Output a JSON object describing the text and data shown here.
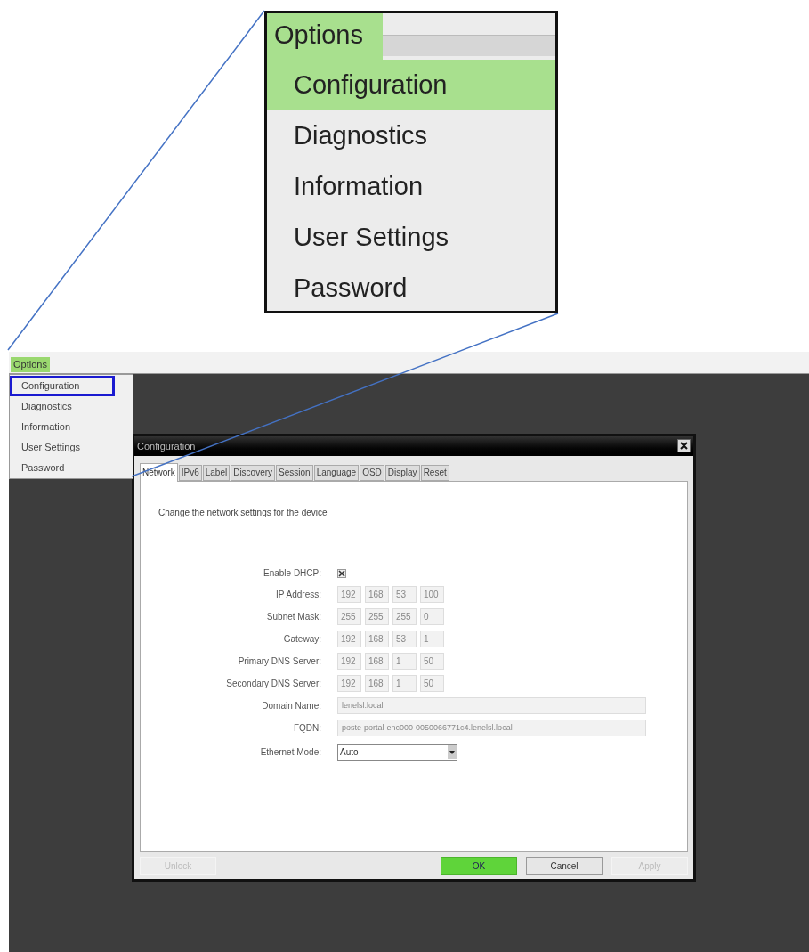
{
  "callout": {
    "menu_title": "Options",
    "items": [
      {
        "label": "Configuration",
        "selected": true
      },
      {
        "label": "Diagnostics",
        "selected": false
      },
      {
        "label": "Information",
        "selected": false
      },
      {
        "label": "User Settings",
        "selected": false
      },
      {
        "label": "Password",
        "selected": false
      }
    ]
  },
  "screen": {
    "menu_title": "Options",
    "menu_items": [
      {
        "label": "Configuration",
        "selected": true
      },
      {
        "label": "Diagnostics",
        "selected": false
      },
      {
        "label": "Information",
        "selected": false
      },
      {
        "label": "User Settings",
        "selected": false
      },
      {
        "label": "Password",
        "selected": false
      }
    ],
    "dialog": {
      "title": "Configuration",
      "tabs": [
        {
          "label": "Network",
          "selected": true
        },
        {
          "label": "IPv6",
          "selected": false
        },
        {
          "label": "Label",
          "selected": false
        },
        {
          "label": "Discovery",
          "selected": false
        },
        {
          "label": "Session",
          "selected": false
        },
        {
          "label": "Language",
          "selected": false
        },
        {
          "label": "OSD",
          "selected": false
        },
        {
          "label": "Display",
          "selected": false
        },
        {
          "label": "Reset",
          "selected": false
        }
      ],
      "description": "Change the network settings for the device",
      "fields": [
        {
          "kind": "checkbox",
          "label": "Enable DHCP:",
          "checked": true
        },
        {
          "kind": "ip",
          "label": "IP Address:",
          "octets": [
            "192",
            "168",
            "53",
            "100"
          ],
          "disabled": true
        },
        {
          "kind": "ip",
          "label": "Subnet Mask:",
          "octets": [
            "255",
            "255",
            "255",
            "0"
          ],
          "disabled": true
        },
        {
          "kind": "ip",
          "label": "Gateway:",
          "octets": [
            "192",
            "168",
            "53",
            "1"
          ],
          "disabled": true
        },
        {
          "kind": "ip",
          "label": "Primary DNS Server:",
          "octets": [
            "192",
            "168",
            "1",
            "50"
          ],
          "disabled": true
        },
        {
          "kind": "ip",
          "label": "Secondary DNS Server:",
          "octets": [
            "192",
            "168",
            "1",
            "50"
          ],
          "disabled": true
        },
        {
          "kind": "text",
          "label": "Domain Name:",
          "value": "lenelsl.local",
          "disabled": true
        },
        {
          "kind": "text",
          "label": "FQDN:",
          "value": "poste-portal-enc000-0050066771c4.lenelsl.local",
          "disabled": true
        },
        {
          "kind": "select",
          "label": "Ethernet Mode:",
          "value": "Auto"
        }
      ],
      "buttons": [
        {
          "label": "Unlock",
          "kind": "normal",
          "disabled": true
        },
        {
          "label": "OK",
          "kind": "primary",
          "disabled": false
        },
        {
          "label": "Cancel",
          "kind": "normal",
          "disabled": false
        },
        {
          "label": "Apply",
          "kind": "normal",
          "disabled": true
        }
      ]
    }
  }
}
